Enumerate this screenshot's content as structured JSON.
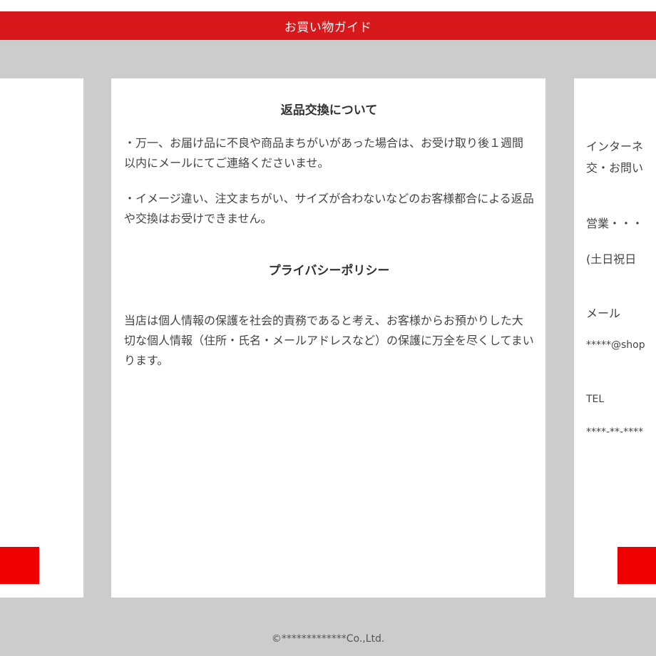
{
  "header": {
    "title": "お買い物ガイド"
  },
  "center": {
    "returns_title": "返品交換について",
    "returns_p1": "・万一、お届け品に不良や商品まちがいがあった場合は、お受け取り後１週間以内にメールにてご連絡くださいませ。",
    "returns_p2": "・イメージ違い、注文まちがい、サイズが合わないなどのお客様都合による返品や交換はお受けできません。",
    "privacy_title": "プライバシーポリシー",
    "privacy_p1": "当店は個人情報の保護を社会的責務であると考え、お客様からお預かりした大切な個人情報（住所・氏名・メールアドレスなど）の保護に万全を尽くしてまいります。"
  },
  "right": {
    "intro_line1": "インターネ",
    "intro_line2": "交・お問い",
    "hours_label": "営業・・・",
    "holiday_label": "(土日祝日",
    "mail_label": "メール",
    "mail_value": "*****@shop",
    "tel_label": "TEL",
    "tel_value": "****-**-****"
  },
  "footer": {
    "copyright": "©*************Co.,Ltd."
  },
  "colors": {
    "header": "#d7191c",
    "button": "#ee0000",
    "background": "#cccccc"
  }
}
